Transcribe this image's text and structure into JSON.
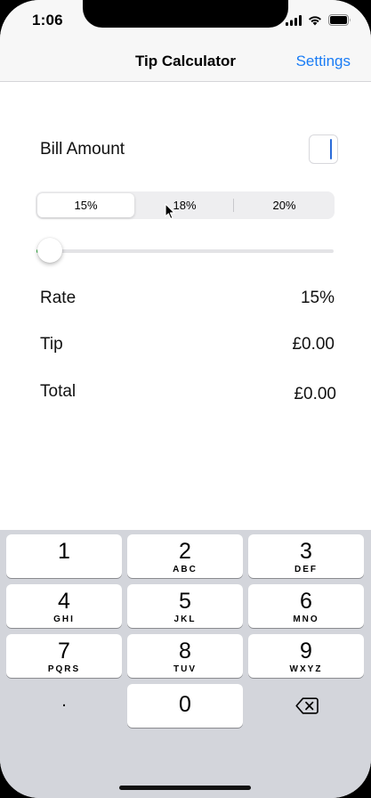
{
  "status": {
    "time": "1:06"
  },
  "nav": {
    "title": "Tip Calculator",
    "settings_label": "Settings"
  },
  "bill": {
    "label": "Bill Amount",
    "value": ""
  },
  "segments": {
    "options": [
      "15%",
      "18%",
      "20%"
    ],
    "selected": "15%"
  },
  "slider": {
    "value_fraction": 0.0,
    "accent": "#3bb34a"
  },
  "results": {
    "rate_label": "Rate",
    "rate_value": "15%",
    "tip_label": "Tip",
    "tip_value": "£0.00",
    "total_label": "Total",
    "total_value": "£0.00"
  },
  "keyboard": {
    "keys": [
      {
        "num": "1",
        "letters": ""
      },
      {
        "num": "2",
        "letters": "ABC"
      },
      {
        "num": "3",
        "letters": "DEF"
      },
      {
        "num": "4",
        "letters": "GHI"
      },
      {
        "num": "5",
        "letters": "JKL"
      },
      {
        "num": "6",
        "letters": "MNO"
      },
      {
        "num": "7",
        "letters": "PQRS"
      },
      {
        "num": "8",
        "letters": "TUV"
      },
      {
        "num": "9",
        "letters": "WXYZ"
      }
    ],
    "decimal": ".",
    "zero": "0",
    "delete_icon": "delete-backspace-icon"
  },
  "colors": {
    "accent_blue": "#1a7cf5",
    "caret": "#2a6bd8"
  }
}
